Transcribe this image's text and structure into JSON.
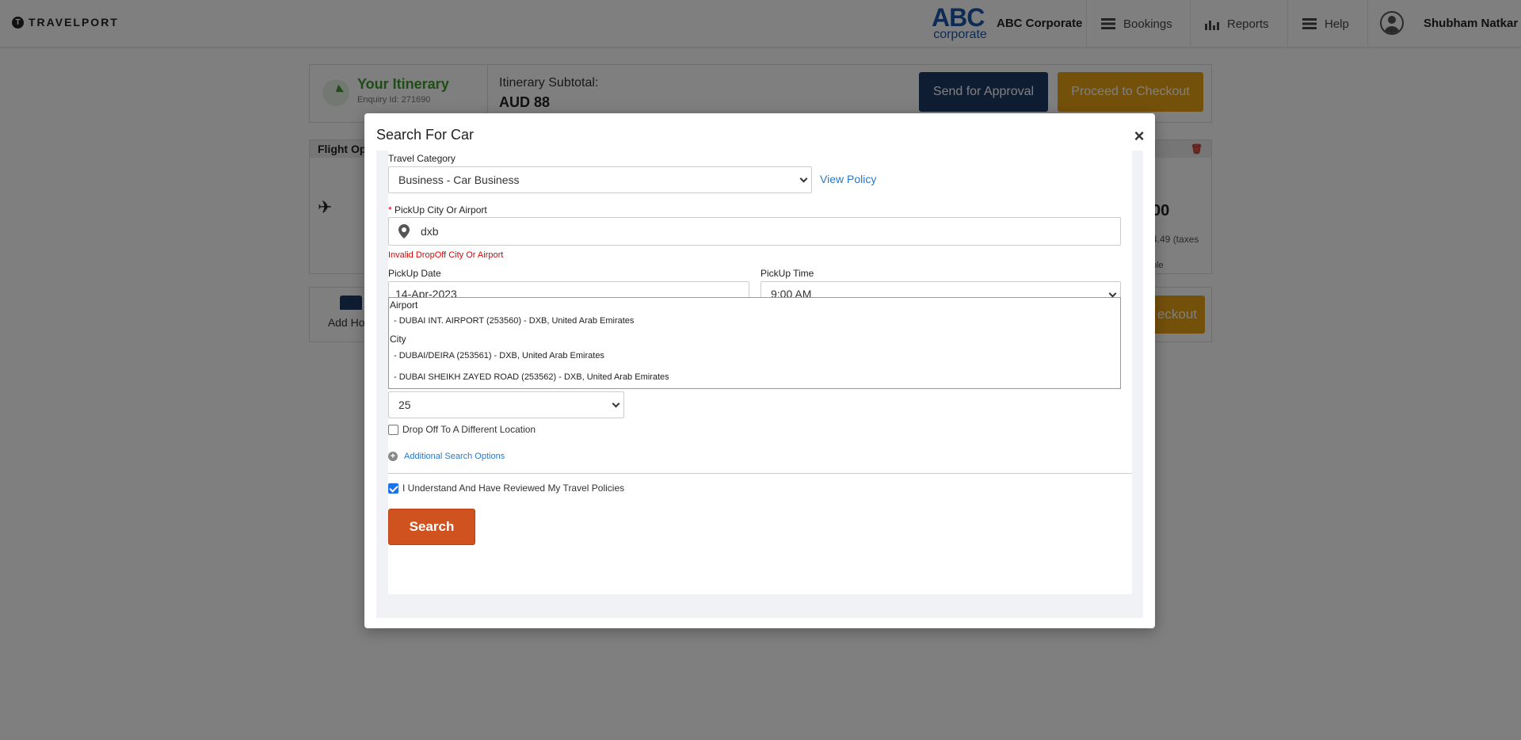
{
  "topbar": {
    "brand": "TRAVELPORT",
    "corp_logo_big": "ABC",
    "corp_logo_small": "corporate",
    "corp_name": "ABC Corporate",
    "nav": [
      "Bookings",
      "Reports",
      "Help"
    ],
    "user_name": "Shubham Natkar"
  },
  "itinerary": {
    "title": "Your Itinerary",
    "enquiry": "Enquiry Id: 271690",
    "subtotal_label": "Itinerary Subtotal:",
    "subtotal_value": "AUD  88",
    "send_approval": "Send for Approval",
    "proceed_checkout": "Proceed to Checkout"
  },
  "flight_panel": {
    "header": "Flight Opt",
    "price_tail": "00",
    "tax_tail": "4.49 (taxes",
    "ble_tail": "ble"
  },
  "addons": {
    "add_hotel": "Add Hote",
    "checkout_tail": "eckout"
  },
  "modal": {
    "title": "Search For Car",
    "close": "×",
    "travel_category_label": "Travel Category",
    "travel_category_value": "Business - Car Business",
    "view_policy": "View Policy",
    "pickup_label_req": "*",
    "pickup_label": "PickUp City Or Airport",
    "pickup_value": "dxb",
    "pickup_error": "Invalid DropOff City Or Airport",
    "pickup_date_label": "PickUp Date",
    "pickup_date_value": "14-Apr-2023",
    "pickup_time_label": "PickUp Time",
    "pickup_time_value": "9:00 AM",
    "dropdown": {
      "group_airport": "Airport",
      "airport_options": [
        "- DUBAI INT. AIRPORT (253560) - DXB, United Arab Emirates"
      ],
      "group_city": "City",
      "city_options": [
        "- DUBAI/DEIRA (253561) - DXB, United Arab Emirates",
        "- DUBAI SHEIKH ZAYED ROAD (253562) - DXB, United Arab Emirates"
      ]
    },
    "age_value": "25",
    "dropoff_different": "Drop Off To A Different Location",
    "additional_options": "Additional Search Options",
    "policy_ack": "I Understand And Have Reviewed My Travel Policies",
    "search_button": "Search"
  }
}
